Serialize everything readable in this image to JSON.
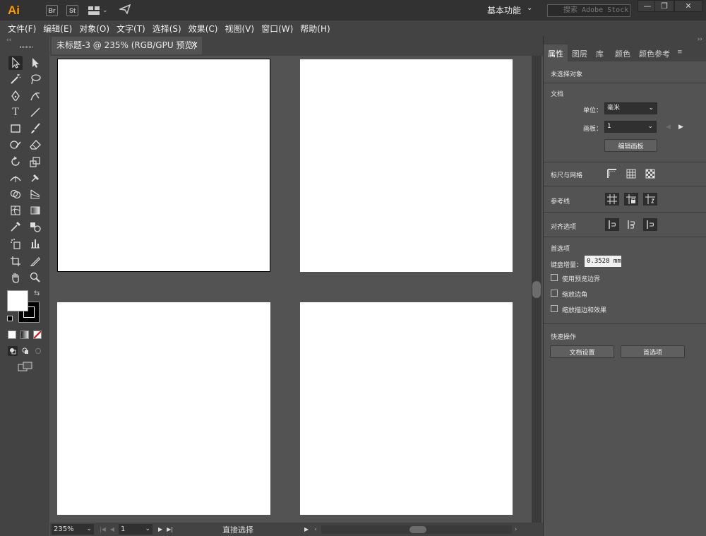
{
  "titlebar": {
    "app_logo": "Ai",
    "bridge_label": "Br",
    "stock_label": "St",
    "workspace_label": "基本功能",
    "search_placeholder": "搜索 Adobe Stock",
    "min": "—",
    "restore": "❐",
    "close": "✕"
  },
  "menu": [
    "文件(F)",
    "编辑(E)",
    "对象(O)",
    "文字(T)",
    "选择(S)",
    "效果(C)",
    "视图(V)",
    "窗口(W)",
    "帮助(H)"
  ],
  "document_tab": {
    "title": "未标题-3 @ 235% (RGB/GPU 预览)",
    "close": "✕"
  },
  "status": {
    "zoom": "235%",
    "artboard_number": "1",
    "current_tool": "直接选择"
  },
  "panel": {
    "tabs": [
      "属性",
      "图层",
      "库",
      "颜色",
      "颜色参考"
    ],
    "active_tab": "属性",
    "no_selection": "未选择对象",
    "document_section": "文档",
    "unit_label": "单位：",
    "unit_value": "毫米",
    "artboard_label": "画板：",
    "artboard_value": "1",
    "edit_artboards": "编辑画板",
    "rulers_grids": "标尺与网格",
    "guides": "参考线",
    "align_options": "对齐选项",
    "preferences_section": "首选项",
    "keyboard_increment_label": "键盘增量：",
    "keyboard_increment_value": "0.3528 mm",
    "use_preview_bounds": "使用预览边界",
    "scale_corners": "缩放边角",
    "scale_strokes_effects": "缩放描边和效果",
    "quick_actions": "快速操作",
    "document_setup": "文档设置",
    "preferences_button": "首选项"
  },
  "icons": {
    "collapse_left": "‹‹",
    "collapse_right": "››",
    "prev_artboard": "◀",
    "next_artboard": "▶"
  },
  "colors": {
    "app_logo": "#ff9a00",
    "canvas": "#535353",
    "artboard": "#ffffff"
  }
}
